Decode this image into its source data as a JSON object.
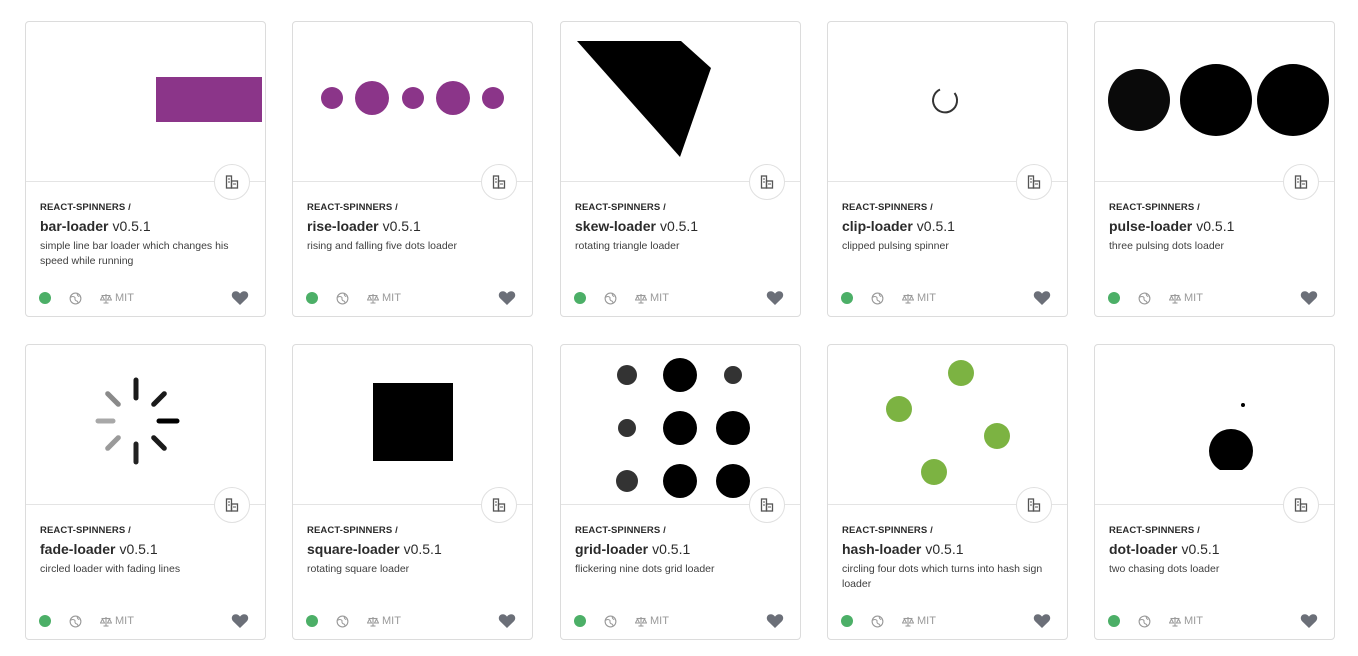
{
  "cards": [
    {
      "scope": "REACT-SPINNERS /",
      "name": "bar-loader",
      "version": "v0.5.1",
      "description": "simple line bar loader which changes his speed while running",
      "license": "MIT",
      "color": "#8b3589"
    },
    {
      "scope": "REACT-SPINNERS /",
      "name": "rise-loader",
      "version": "v0.5.1",
      "description": "rising and falling five dots loader",
      "license": "MIT",
      "color": "#8b3589"
    },
    {
      "scope": "REACT-SPINNERS /",
      "name": "skew-loader",
      "version": "v0.5.1",
      "description": "rotating triangle loader",
      "license": "MIT",
      "color": "#000000"
    },
    {
      "scope": "REACT-SPINNERS /",
      "name": "clip-loader",
      "version": "v0.5.1",
      "description": "clipped pulsing spinner",
      "license": "MIT",
      "color": "#333333"
    },
    {
      "scope": "REACT-SPINNERS /",
      "name": "pulse-loader",
      "version": "v0.5.1",
      "description": "three pulsing dots loader",
      "license": "MIT",
      "color": "#000000"
    },
    {
      "scope": "REACT-SPINNERS /",
      "name": "fade-loader",
      "version": "v0.5.1",
      "description": "circled loader with fading lines",
      "license": "MIT",
      "color": "#1a1a1a"
    },
    {
      "scope": "REACT-SPINNERS /",
      "name": "square-loader",
      "version": "v0.5.1",
      "description": "rotating square loader",
      "license": "MIT",
      "color": "#000000"
    },
    {
      "scope": "REACT-SPINNERS /",
      "name": "grid-loader",
      "version": "v0.5.1",
      "description": "flickering nine dots grid loader",
      "license": "MIT",
      "color": "#000000"
    },
    {
      "scope": "REACT-SPINNERS /",
      "name": "hash-loader",
      "version": "v0.5.1",
      "description": "circling four dots which turns into hash sign loader",
      "license": "MIT",
      "color": "#7cb342"
    },
    {
      "scope": "REACT-SPINNERS /",
      "name": "dot-loader",
      "version": "v0.5.1",
      "description": "two chasing dots loader",
      "license": "MIT",
      "color": "#000000"
    }
  ],
  "colors": {
    "status": "#4caf67",
    "icon": "#9a9a9a",
    "heart": "#6b6f78"
  },
  "icons": {
    "bundle": "bundle-size-icon",
    "globe": "globe-icon",
    "license": "scale-icon",
    "heart": "heart-icon"
  }
}
